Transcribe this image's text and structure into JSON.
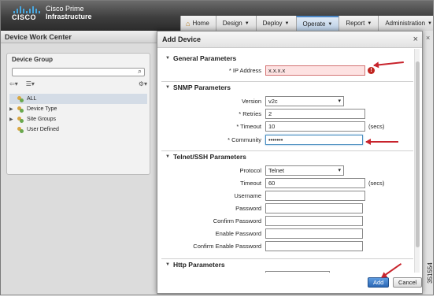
{
  "header": {
    "brand": "CISCO",
    "product_line1": "Cisco Prime",
    "product_line2": "Infrastructure",
    "tabs": [
      {
        "label": "Home",
        "icon": "home-icon"
      },
      {
        "label": "Design"
      },
      {
        "label": "Deploy"
      },
      {
        "label": "Operate",
        "active": true
      },
      {
        "label": "Report"
      },
      {
        "label": "Administration"
      }
    ]
  },
  "workcenter": {
    "title": "Device Work Center",
    "group_panel_title": "Device Group",
    "tree": [
      {
        "label": "ALL",
        "selected": true,
        "expandable": false
      },
      {
        "label": "Device Type",
        "expandable": true
      },
      {
        "label": "Site Groups",
        "expandable": true
      },
      {
        "label": "User Defined",
        "expandable": false
      }
    ]
  },
  "dialog": {
    "title": "Add Device",
    "sections": {
      "general": {
        "title": "General Parameters",
        "ip_label": "* IP Address",
        "ip_value": "x.x.x.x",
        "ip_error": true
      },
      "snmp": {
        "title": "SNMP Parameters",
        "version_label": "Version",
        "version_value": "v2c",
        "retries_label": "* Retries",
        "retries_value": "2",
        "timeout_label": "* Timeout",
        "timeout_value": "10",
        "timeout_unit": "(secs)",
        "community_label": "* Community",
        "community_value": "•••••••"
      },
      "telnet": {
        "title": "Telnet/SSH Parameters",
        "protocol_label": "Protocol",
        "protocol_value": "Telnet",
        "timeout_label": "Timeout",
        "timeout_value": "60",
        "timeout_unit": "(secs)",
        "username_label": "Username",
        "password_label": "Password",
        "confirm_password_label": "Confirm Password",
        "enable_password_label": "Enable Password",
        "confirm_enable_password_label": "Confirm Enable Password"
      },
      "http": {
        "title": "Http Parameters"
      }
    },
    "add_label": "Add",
    "cancel_label": "Cancel"
  },
  "figure_id": "351554",
  "colors": {
    "accent": "#2c68b5",
    "error": "#c0241e",
    "callout_arrow": "#c8232c"
  }
}
